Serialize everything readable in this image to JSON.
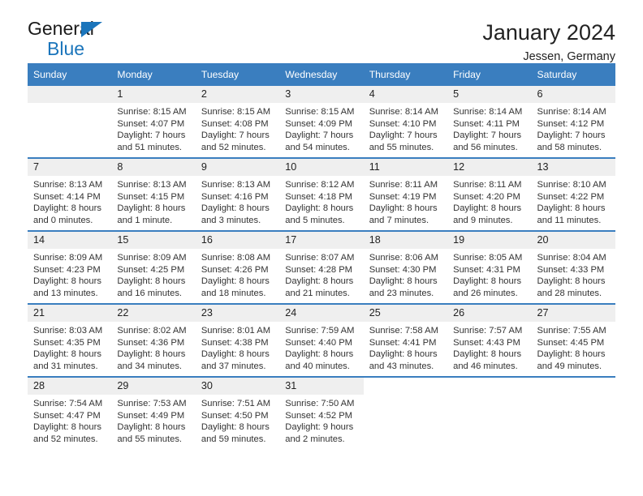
{
  "brand": {
    "name_part1": "General",
    "name_part2": "Blue",
    "accent_color": "#1b75bb"
  },
  "header": {
    "title": "January 2024",
    "subtitle": "Jessen, Germany"
  },
  "theme": {
    "header_bg": "#3a7ebf",
    "daynum_bg": "#efefef",
    "text_color": "#222222"
  },
  "weekdays": [
    "Sunday",
    "Monday",
    "Tuesday",
    "Wednesday",
    "Thursday",
    "Friday",
    "Saturday"
  ],
  "labels": {
    "sunrise_prefix": "Sunrise:",
    "sunset_prefix": "Sunset:",
    "daylight_prefix": "Daylight:"
  },
  "weeks": [
    [
      {
        "day": "",
        "empty": true,
        "line1": "",
        "line2": "",
        "line3": "",
        "line4": ""
      },
      {
        "day": "1",
        "line1": "Sunrise: 8:15 AM",
        "line2": "Sunset: 4:07 PM",
        "line3": "Daylight: 7 hours",
        "line4": "and 51 minutes."
      },
      {
        "day": "2",
        "line1": "Sunrise: 8:15 AM",
        "line2": "Sunset: 4:08 PM",
        "line3": "Daylight: 7 hours",
        "line4": "and 52 minutes."
      },
      {
        "day": "3",
        "line1": "Sunrise: 8:15 AM",
        "line2": "Sunset: 4:09 PM",
        "line3": "Daylight: 7 hours",
        "line4": "and 54 minutes."
      },
      {
        "day": "4",
        "line1": "Sunrise: 8:14 AM",
        "line2": "Sunset: 4:10 PM",
        "line3": "Daylight: 7 hours",
        "line4": "and 55 minutes."
      },
      {
        "day": "5",
        "line1": "Sunrise: 8:14 AM",
        "line2": "Sunset: 4:11 PM",
        "line3": "Daylight: 7 hours",
        "line4": "and 56 minutes."
      },
      {
        "day": "6",
        "line1": "Sunrise: 8:14 AM",
        "line2": "Sunset: 4:12 PM",
        "line3": "Daylight: 7 hours",
        "line4": "and 58 minutes."
      }
    ],
    [
      {
        "day": "7",
        "line1": "Sunrise: 8:13 AM",
        "line2": "Sunset: 4:14 PM",
        "line3": "Daylight: 8 hours",
        "line4": "and 0 minutes."
      },
      {
        "day": "8",
        "line1": "Sunrise: 8:13 AM",
        "line2": "Sunset: 4:15 PM",
        "line3": "Daylight: 8 hours",
        "line4": "and 1 minute."
      },
      {
        "day": "9",
        "line1": "Sunrise: 8:13 AM",
        "line2": "Sunset: 4:16 PM",
        "line3": "Daylight: 8 hours",
        "line4": "and 3 minutes."
      },
      {
        "day": "10",
        "line1": "Sunrise: 8:12 AM",
        "line2": "Sunset: 4:18 PM",
        "line3": "Daylight: 8 hours",
        "line4": "and 5 minutes."
      },
      {
        "day": "11",
        "line1": "Sunrise: 8:11 AM",
        "line2": "Sunset: 4:19 PM",
        "line3": "Daylight: 8 hours",
        "line4": "and 7 minutes."
      },
      {
        "day": "12",
        "line1": "Sunrise: 8:11 AM",
        "line2": "Sunset: 4:20 PM",
        "line3": "Daylight: 8 hours",
        "line4": "and 9 minutes."
      },
      {
        "day": "13",
        "line1": "Sunrise: 8:10 AM",
        "line2": "Sunset: 4:22 PM",
        "line3": "Daylight: 8 hours",
        "line4": "and 11 minutes."
      }
    ],
    [
      {
        "day": "14",
        "line1": "Sunrise: 8:09 AM",
        "line2": "Sunset: 4:23 PM",
        "line3": "Daylight: 8 hours",
        "line4": "and 13 minutes."
      },
      {
        "day": "15",
        "line1": "Sunrise: 8:09 AM",
        "line2": "Sunset: 4:25 PM",
        "line3": "Daylight: 8 hours",
        "line4": "and 16 minutes."
      },
      {
        "day": "16",
        "line1": "Sunrise: 8:08 AM",
        "line2": "Sunset: 4:26 PM",
        "line3": "Daylight: 8 hours",
        "line4": "and 18 minutes."
      },
      {
        "day": "17",
        "line1": "Sunrise: 8:07 AM",
        "line2": "Sunset: 4:28 PM",
        "line3": "Daylight: 8 hours",
        "line4": "and 21 minutes."
      },
      {
        "day": "18",
        "line1": "Sunrise: 8:06 AM",
        "line2": "Sunset: 4:30 PM",
        "line3": "Daylight: 8 hours",
        "line4": "and 23 minutes."
      },
      {
        "day": "19",
        "line1": "Sunrise: 8:05 AM",
        "line2": "Sunset: 4:31 PM",
        "line3": "Daylight: 8 hours",
        "line4": "and 26 minutes."
      },
      {
        "day": "20",
        "line1": "Sunrise: 8:04 AM",
        "line2": "Sunset: 4:33 PM",
        "line3": "Daylight: 8 hours",
        "line4": "and 28 minutes."
      }
    ],
    [
      {
        "day": "21",
        "line1": "Sunrise: 8:03 AM",
        "line2": "Sunset: 4:35 PM",
        "line3": "Daylight: 8 hours",
        "line4": "and 31 minutes."
      },
      {
        "day": "22",
        "line1": "Sunrise: 8:02 AM",
        "line2": "Sunset: 4:36 PM",
        "line3": "Daylight: 8 hours",
        "line4": "and 34 minutes."
      },
      {
        "day": "23",
        "line1": "Sunrise: 8:01 AM",
        "line2": "Sunset: 4:38 PM",
        "line3": "Daylight: 8 hours",
        "line4": "and 37 minutes."
      },
      {
        "day": "24",
        "line1": "Sunrise: 7:59 AM",
        "line2": "Sunset: 4:40 PM",
        "line3": "Daylight: 8 hours",
        "line4": "and 40 minutes."
      },
      {
        "day": "25",
        "line1": "Sunrise: 7:58 AM",
        "line2": "Sunset: 4:41 PM",
        "line3": "Daylight: 8 hours",
        "line4": "and 43 minutes."
      },
      {
        "day": "26",
        "line1": "Sunrise: 7:57 AM",
        "line2": "Sunset: 4:43 PM",
        "line3": "Daylight: 8 hours",
        "line4": "and 46 minutes."
      },
      {
        "day": "27",
        "line1": "Sunrise: 7:55 AM",
        "line2": "Sunset: 4:45 PM",
        "line3": "Daylight: 8 hours",
        "line4": "and 49 minutes."
      }
    ],
    [
      {
        "day": "28",
        "line1": "Sunrise: 7:54 AM",
        "line2": "Sunset: 4:47 PM",
        "line3": "Daylight: 8 hours",
        "line4": "and 52 minutes."
      },
      {
        "day": "29",
        "line1": "Sunrise: 7:53 AM",
        "line2": "Sunset: 4:49 PM",
        "line3": "Daylight: 8 hours",
        "line4": "and 55 minutes."
      },
      {
        "day": "30",
        "line1": "Sunrise: 7:51 AM",
        "line2": "Sunset: 4:50 PM",
        "line3": "Daylight: 8 hours",
        "line4": "and 59 minutes."
      },
      {
        "day": "31",
        "line1": "Sunrise: 7:50 AM",
        "line2": "Sunset: 4:52 PM",
        "line3": "Daylight: 9 hours",
        "line4": "and 2 minutes."
      },
      {
        "day": "",
        "blank": true,
        "line1": "",
        "line2": "",
        "line3": "",
        "line4": ""
      },
      {
        "day": "",
        "blank": true,
        "line1": "",
        "line2": "",
        "line3": "",
        "line4": ""
      },
      {
        "day": "",
        "blank": true,
        "line1": "",
        "line2": "",
        "line3": "",
        "line4": ""
      }
    ]
  ]
}
